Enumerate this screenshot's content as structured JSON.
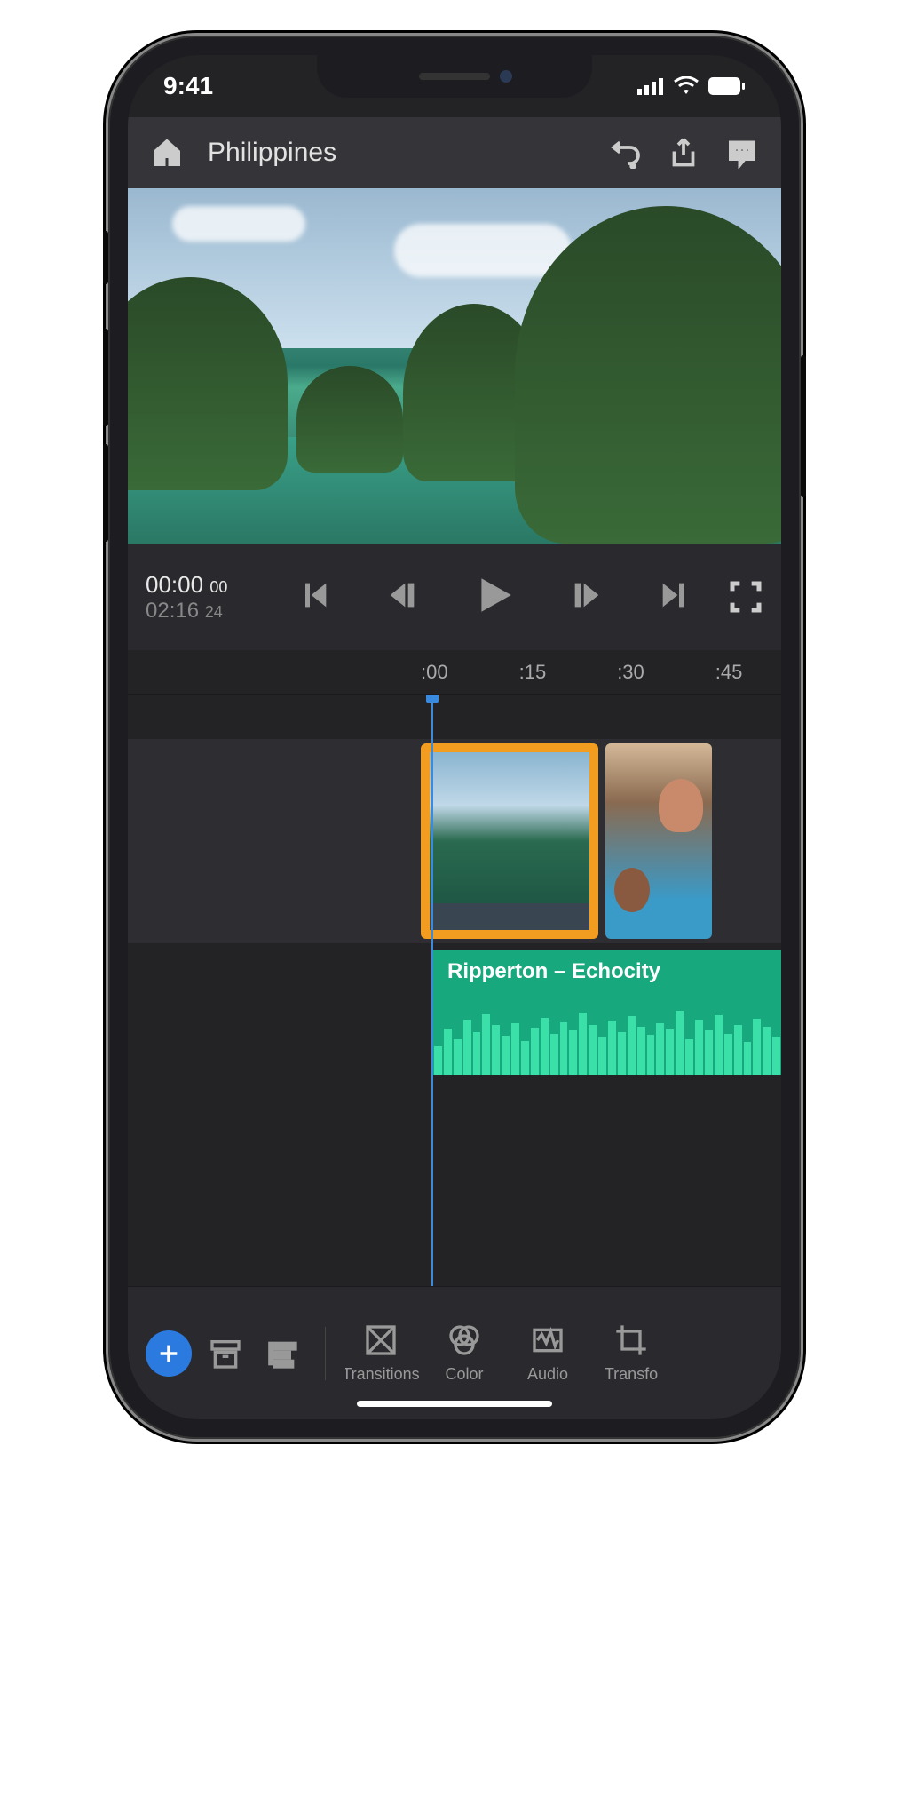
{
  "status": {
    "time": "9:41"
  },
  "header": {
    "title": "Philippines"
  },
  "transport": {
    "current_tc": "00:00",
    "current_frames": "00",
    "total_tc": "02:16",
    "total_frames": "24"
  },
  "ruler": {
    "marks": [
      ":00",
      ":15",
      ":30",
      ":45"
    ]
  },
  "audio": {
    "clip_label": "Ripperton – Echocity"
  },
  "toolbar": {
    "tools": [
      {
        "id": "transitions",
        "label": "Transitions"
      },
      {
        "id": "color",
        "label": "Color"
      },
      {
        "id": "audio",
        "label": "Audio"
      },
      {
        "id": "transform",
        "label": "Transfo"
      }
    ]
  }
}
